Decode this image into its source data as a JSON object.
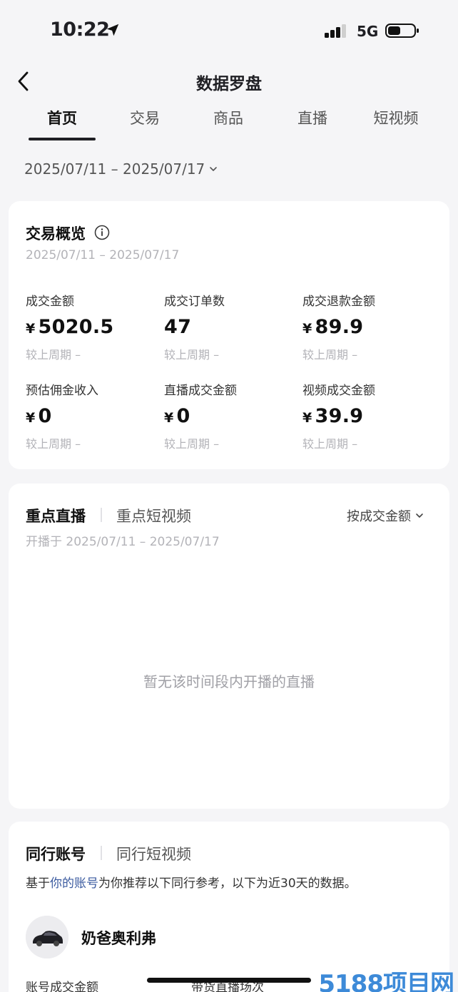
{
  "status": {
    "time": "10:22",
    "network": "5G"
  },
  "nav": {
    "title": "数据罗盘"
  },
  "tabs": [
    {
      "label": "首页",
      "active": true
    },
    {
      "label": "交易"
    },
    {
      "label": "商品"
    },
    {
      "label": "直播"
    },
    {
      "label": "短视频"
    }
  ],
  "date_range": "2025/07/11 – 2025/07/17",
  "overview": {
    "title": "交易概览",
    "date": "2025/07/11 – 2025/07/17",
    "currency": "¥",
    "metrics": [
      {
        "label": "成交金额",
        "value": "5020.5",
        "currency": true,
        "cmp": "较上周期 –"
      },
      {
        "label": "成交订单数",
        "value": "47",
        "currency": false,
        "cmp": "较上周期 –"
      },
      {
        "label": "成交退款金额",
        "value": "89.9",
        "currency": true,
        "cmp": "较上周期 –"
      },
      {
        "label": "预估佣金收入",
        "value": "0",
        "currency": true,
        "cmp": "较上周期 –"
      },
      {
        "label": "直播成交金额",
        "value": "0",
        "currency": true,
        "cmp": "较上周期 –"
      },
      {
        "label": "视频成交金额",
        "value": "39.9",
        "currency": true,
        "cmp": "较上周期 –"
      }
    ]
  },
  "live": {
    "tab_active": "重点直播",
    "tab_other": "重点短视频",
    "sort": "按成交金额",
    "date": "开播于 2025/07/11 – 2025/07/17",
    "empty": "暂无该时间段内开播的直播"
  },
  "peers": {
    "tab_active": "同行账号",
    "tab_other": "同行短视频",
    "desc_pre": "基于",
    "desc_link": "你的账号",
    "desc_post": "为你推荐以下同行参考，以下为近30天的数据。",
    "name": "奶爸奥利弗",
    "stat1": "账号成交金额",
    "stat2": "带货直播场次"
  },
  "watermark": "5188项目网",
  "colors": {
    "link": "#3a5a9f",
    "muted": "#b3b3b8",
    "watermark": "#3d8ad8"
  }
}
